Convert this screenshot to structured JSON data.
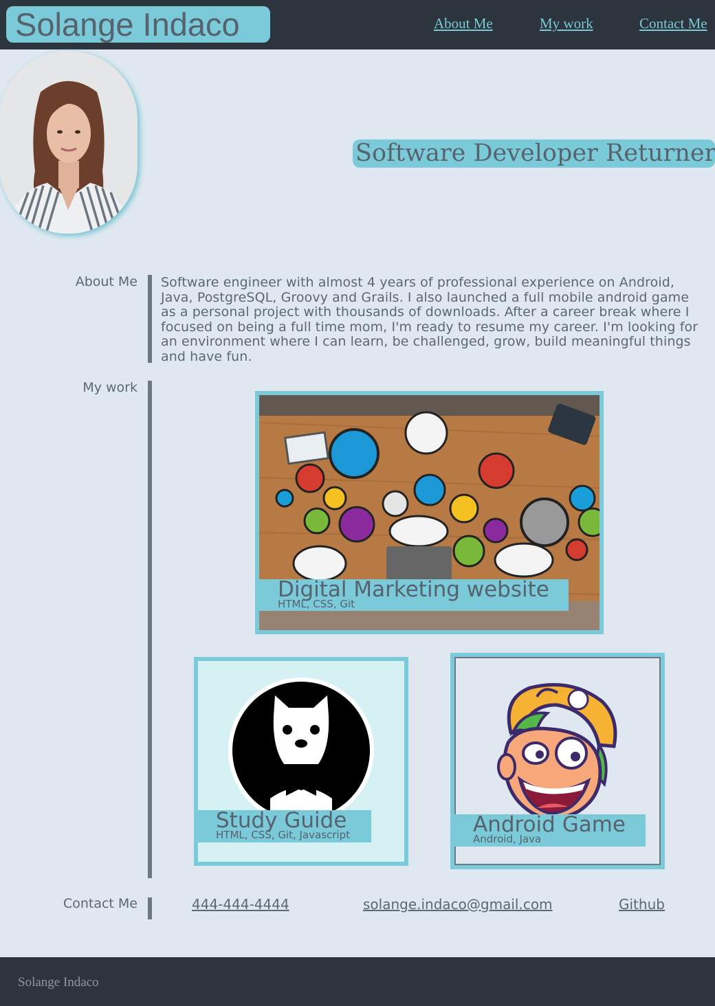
{
  "header": {
    "brand": "Solange Indaco",
    "nav": [
      "About Me",
      "My work",
      "Contact Me"
    ]
  },
  "hero": {
    "title": "Software Developer Returner",
    "avatar_alt": "Portrait photo of Solange Indaco"
  },
  "about": {
    "label": "About Me",
    "text": "Software engineer with almost 4 years of professional experience on Android, Java, PostgreSQL, Groovy and Grails. I also launched a full mobile android game as a personal project with thousands of downloads. After a career break where I focused on being a full time mom, I'm ready to resume my career. I'm looking for an environment where I can learn, be challenged, grow, build meaningful things and have fun."
  },
  "work": {
    "label": "My work",
    "projects": [
      {
        "title": "Digital Marketing website",
        "stack": "HTML, CSS, Git"
      },
      {
        "title": "Study Guide",
        "stack": "HTML, CSS, Git, Javascript"
      },
      {
        "title": "Android Game",
        "stack": "Android, Java"
      }
    ]
  },
  "contact": {
    "label": "Contact Me",
    "phone": "444-444-4444",
    "email": "solange.indaco@gmail.com",
    "github": "Github"
  },
  "footer": {
    "text": "Solange Indaco"
  },
  "colors": {
    "accent": "#7acad9",
    "dark": "#2c343d",
    "background": "#dfe8f1",
    "text": "#5c6770"
  }
}
